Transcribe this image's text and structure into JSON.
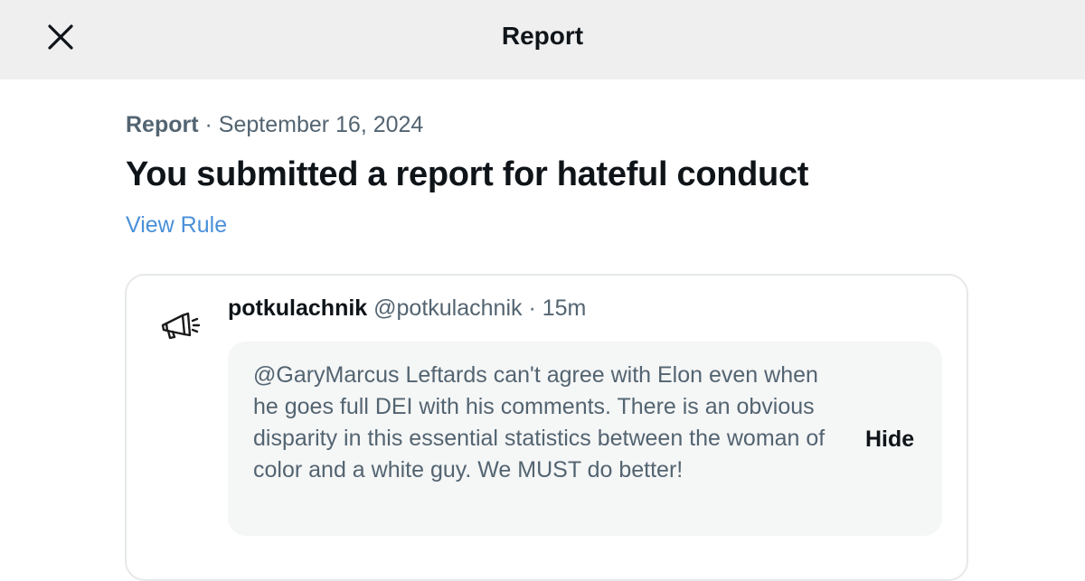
{
  "header": {
    "title": "Report",
    "close_icon": "close-icon"
  },
  "report": {
    "kind": "Report",
    "separator": " · ",
    "date": "September 16, 2024",
    "headline": "You submitted a report for hateful conduct",
    "view_rule_label": "View Rule"
  },
  "post": {
    "avatar_icon": "megaphone-icon",
    "author_name": "potkulachnik",
    "author_handle": "@potkulachnik",
    "separator": " · ",
    "time": "15m",
    "text": "@GaryMarcus Leftards can't agree with Elon even when he goes full DEI with his comments. There is an obvious disparity in this essential statistics between the woman of color and a white guy. We MUST do better!",
    "hide_label": "Hide"
  },
  "colors": {
    "link": "#4a90d9",
    "muted": "#536471",
    "text": "#0f1419",
    "header_bg": "#efefef",
    "quote_bg": "#f5f6f6"
  }
}
